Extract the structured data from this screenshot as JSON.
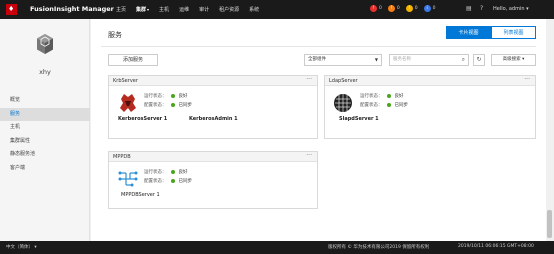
{
  "app": {
    "logo_text": "♦",
    "title": "FusionInsight Manager"
  },
  "nav": {
    "items": [
      {
        "label": "主页"
      },
      {
        "label": "集群",
        "active": true
      },
      {
        "label": "主机"
      },
      {
        "label": "运维"
      },
      {
        "label": "审计"
      },
      {
        "label": "租户资源"
      },
      {
        "label": "系统"
      }
    ]
  },
  "alerts": [
    {
      "icon": "critical-alert-icon",
      "color": "#e8312f",
      "count": "0"
    },
    {
      "icon": "major-alert-icon",
      "color": "#f57f17",
      "count": "0"
    },
    {
      "icon": "minor-alert-icon",
      "color": "#f4b400",
      "count": "0"
    },
    {
      "icon": "warning-alert-icon",
      "color": "#3b78e7",
      "count": "0"
    }
  ],
  "top_icons": [
    "task-list-icon",
    "help-icon"
  ],
  "user": {
    "label": "Hello, admin ▾"
  },
  "sidebar": {
    "host_name": "xhy",
    "items": [
      {
        "label": "概览"
      },
      {
        "label": "服务",
        "active": true
      },
      {
        "label": "主机"
      },
      {
        "label": "集群属性"
      },
      {
        "label": "静态服务池"
      },
      {
        "label": "客户端"
      }
    ]
  },
  "main": {
    "title": "服务",
    "tabs": [
      {
        "label": "卡片视图",
        "active": true
      },
      {
        "label": "列表视图"
      }
    ],
    "add_button": "添加服务",
    "filter": {
      "value": "全部组件"
    },
    "search": {
      "placeholder": "服务名称"
    },
    "advanced_search": "高级搜索 ▾"
  },
  "status_labels": {
    "running": "运行状态：",
    "config": "配置状态："
  },
  "services": [
    {
      "name": "KrbServer",
      "running": "良好",
      "config": "已同步",
      "roles": [
        "KerberosServer 1",
        "KerberosAdmin 1"
      ],
      "icon": "krbserver-logo-icon"
    },
    {
      "name": "LdapServer",
      "running": "良好",
      "config": "已同步",
      "roles": [
        "SlapdServer 1"
      ],
      "icon": "ldapserver-logo-icon"
    },
    {
      "name": "MPPDB",
      "running": "良好",
      "config": "已同步",
      "roles": [
        "MPPDBServer 1"
      ],
      "icon": "mppdb-logo-icon"
    }
  ],
  "footer": {
    "language": "中文（简体） ▾",
    "copyright": "版权所有 © 华为技术有限公司2019 保留所有权利",
    "datetime": "2019/10/11 06:06:15 GMT+08:00"
  },
  "colors": {
    "accent": "#0078d7",
    "topbar": "#1a1a1a",
    "good": "#49a51c",
    "brand": "#c7000b"
  }
}
